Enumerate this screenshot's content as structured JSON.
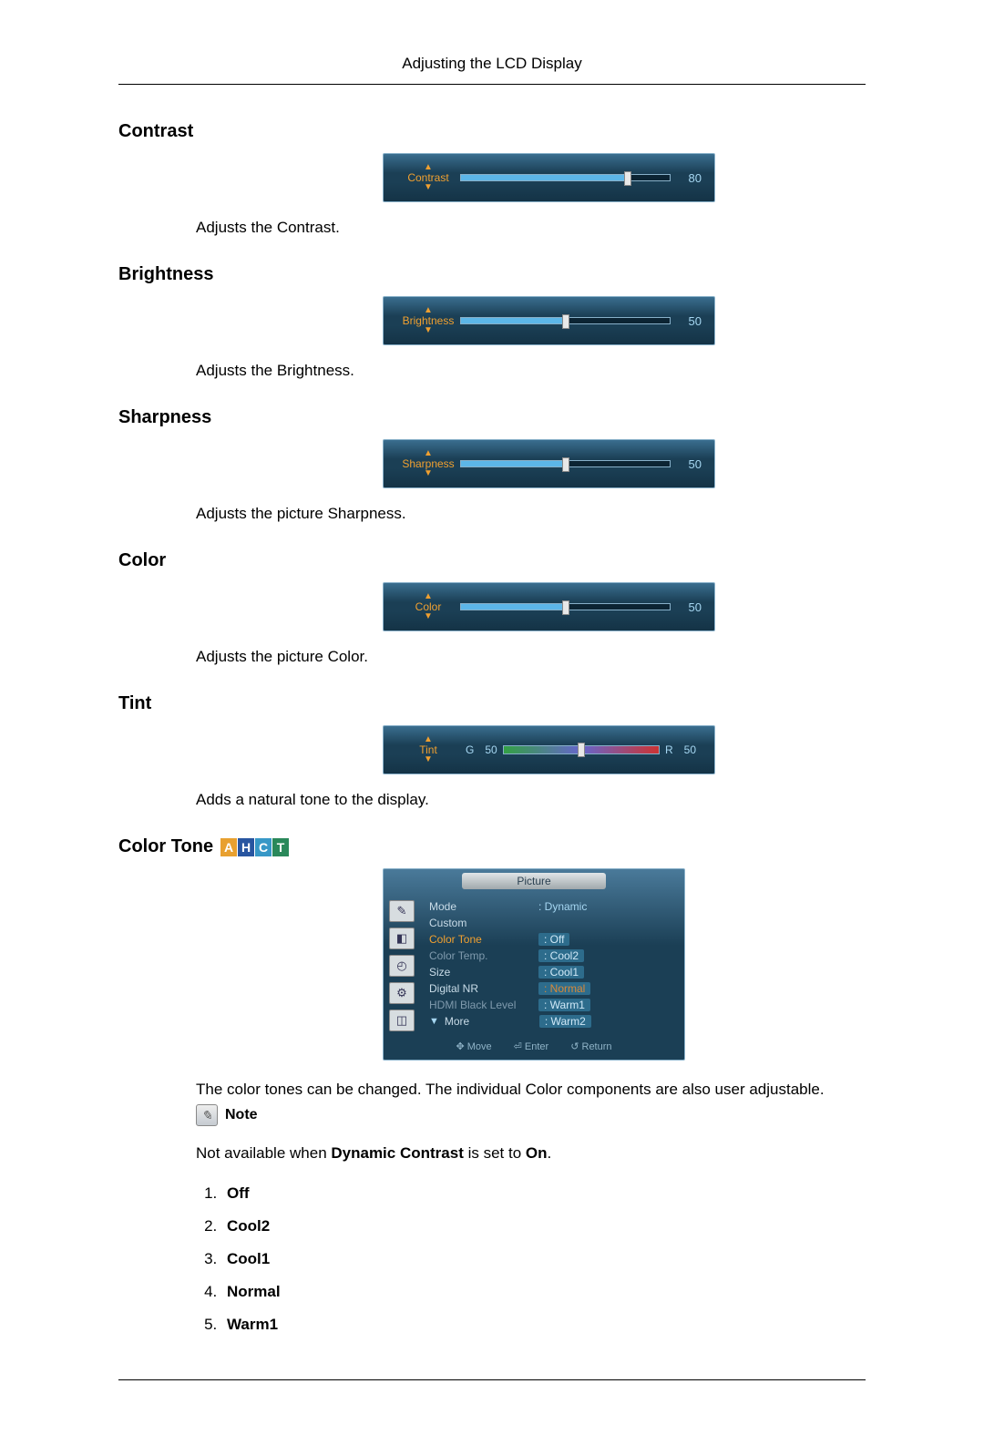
{
  "header": {
    "title": "Adjusting the LCD Display"
  },
  "sections": {
    "contrast": {
      "heading": "Contrast",
      "desc": "Adjusts the Contrast.",
      "osd": {
        "label": "Contrast",
        "value": "80",
        "percent": 80
      }
    },
    "brightness": {
      "heading": "Brightness",
      "desc": "Adjusts the Brightness.",
      "osd": {
        "label": "Brightness",
        "value": "50",
        "percent": 50
      }
    },
    "sharpness": {
      "heading": "Sharpness",
      "desc": "Adjusts the picture Sharpness.",
      "osd": {
        "label": "Sharpness",
        "value": "50",
        "percent": 50
      }
    },
    "color": {
      "heading": "Color",
      "desc": "Adjusts the picture Color.",
      "osd": {
        "label": "Color",
        "value": "50",
        "percent": 50
      }
    },
    "tint": {
      "heading": "Tint",
      "desc": "Adds a natural tone to the display.",
      "osd": {
        "label": "Tint",
        "g_label": "G",
        "g_value": "50",
        "r_label": "R",
        "r_value": "50",
        "percent": 50
      }
    }
  },
  "color_tone": {
    "heading": "Color Tone",
    "badges": {
      "a": "A",
      "h": "H",
      "c": "C",
      "t": "T"
    },
    "menu": {
      "title": "Picture",
      "items": [
        {
          "label": "Mode",
          "value": ": Dynamic",
          "dim": false
        },
        {
          "label": "Custom",
          "value": "",
          "dim": false
        },
        {
          "label": "Color Tone",
          "value": ": Off",
          "orange": true,
          "highlight": true
        },
        {
          "label": "Color Temp.",
          "value": ": Cool2",
          "dim": true,
          "highlight": true
        },
        {
          "label": "Size",
          "value": ": Cool1",
          "highlight": true
        },
        {
          "label": "Digital NR",
          "value": ": Normal",
          "highlight": true,
          "sel": true
        },
        {
          "label": "HDMI Black Level",
          "value": ": Warm1",
          "dim": true,
          "highlight": true
        },
        {
          "label": "More",
          "value": ": Warm2",
          "arrow": true,
          "highlight": true
        }
      ],
      "footer": {
        "move": "Move",
        "enter": "Enter",
        "ret": "Return"
      }
    },
    "para": "The color tones can be changed. The individual Color components are also user adjustable.",
    "note_label": "Note",
    "note_text_pre": "Not available when ",
    "note_text_b1": "Dynamic Contrast",
    "note_text_mid": " is set to ",
    "note_text_b2": "On",
    "note_text_post": ".",
    "options": [
      "Off",
      "Cool2",
      "Cool1",
      "Normal",
      "Warm1"
    ]
  }
}
